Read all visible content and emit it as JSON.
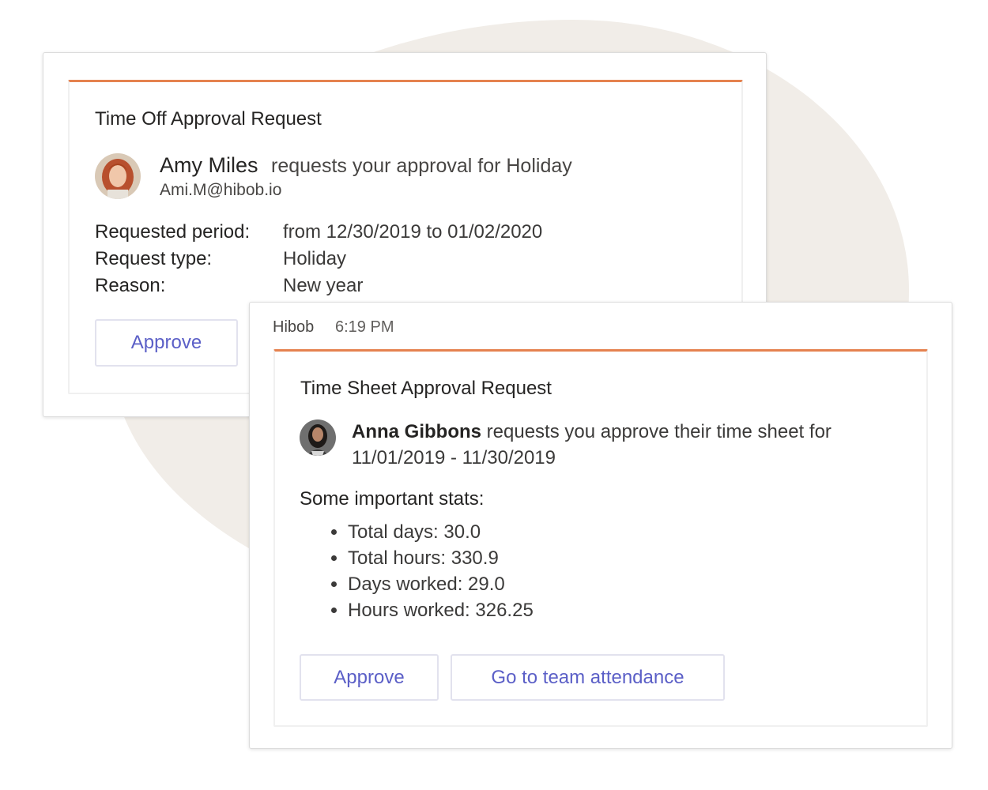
{
  "time_off_card": {
    "title": "Time Off Approval Request",
    "requester_name": "Amy Miles",
    "request_text": "requests your approval for Holiday",
    "requester_email": "Ami.M@hibob.io",
    "details": [
      {
        "label": "Requested period:",
        "value": "from 12/30/2019 to 01/02/2020"
      },
      {
        "label": "Request type:",
        "value": "Holiday"
      },
      {
        "label": "Reason:",
        "value": "New year"
      }
    ],
    "approve_label": "Approve"
  },
  "time_sheet_message": {
    "sender": "Hibob",
    "timestamp": "6:19 PM",
    "card": {
      "title": "Time Sheet Approval Request",
      "requester_name": "Anna Gibbons",
      "request_text": "requests you approve their time sheet for",
      "period": "11/01/2019 - 11/30/2019",
      "stats_heading": "Some important stats:",
      "stats": [
        "Total days: 30.0",
        "Total hours: 330.9",
        "Days worked: 29.0",
        "Hours worked: 326.25"
      ],
      "approve_label": "Approve",
      "attendance_label": "Go to team attendance"
    }
  },
  "colors": {
    "accent_orange": "#e5824f",
    "button_text": "#5b5fc7",
    "blob_background": "#f1ede8"
  }
}
